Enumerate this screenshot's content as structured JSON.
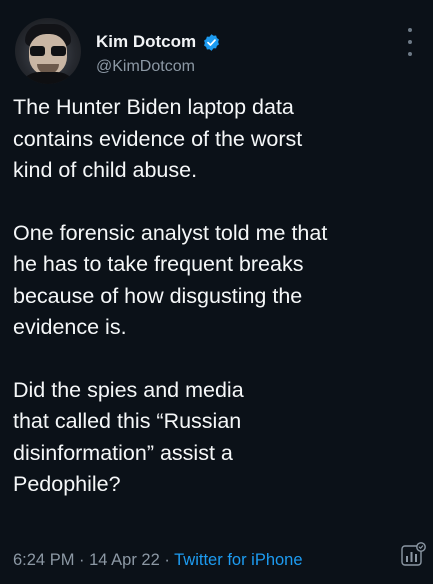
{
  "author": {
    "display_name": "Kim Dotcom",
    "handle": "@KimDotcom",
    "verified": true
  },
  "tweet": {
    "paragraphs": [
      "The Hunter Biden laptop data\ncontains evidence of the worst\nkind of child abuse.",
      "One forensic analyst told me that\nhe has to take frequent breaks\nbecause of how disgusting the\nevidence is.",
      "Did the spies and media\nthat called this “Russian\ndisinformation” assist a\nPedophile?"
    ],
    "time": "6:24 PM",
    "separator_1": " · ",
    "date": "14 Apr 22",
    "separator_2": " · ",
    "source": "Twitter for iPhone"
  },
  "icons": {
    "verified": "verified-badge-icon",
    "more": "more-options-icon",
    "analytics": "tweet-analytics-icon"
  },
  "colors": {
    "background": "#0b1118",
    "accent": "#1d9bf0",
    "secondary_text": "#8c98a4",
    "primary_text": "#f5f7f8"
  }
}
